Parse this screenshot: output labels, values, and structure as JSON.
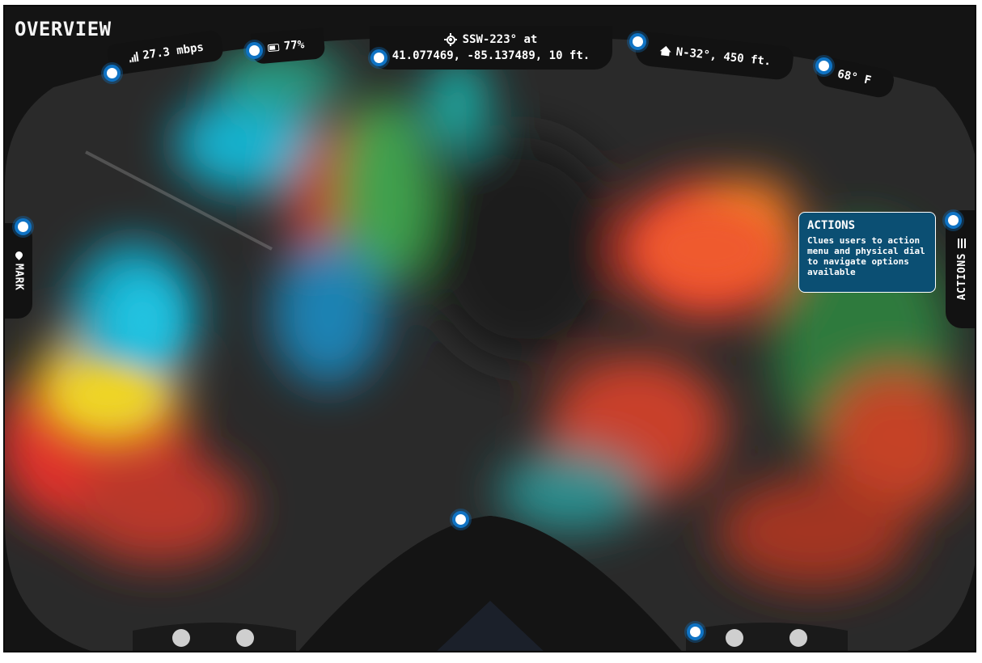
{
  "screen": {
    "title": "OVERVIEW"
  },
  "status": {
    "signal": {
      "icon": "signal-bars-icon",
      "value": "27.3 mbps"
    },
    "battery": {
      "icon": "battery-icon",
      "value": "77%"
    },
    "location": {
      "icon": "crosshair-icon",
      "heading": "SSW-223° at",
      "coordinates": "41.077469, -85.137489, 10 ft."
    },
    "home": {
      "icon": "home-icon",
      "value": "N-32°, 450 ft."
    },
    "temperature": {
      "value": "68° F"
    }
  },
  "left_tab": {
    "icon": "marker-icon",
    "label": "MARK"
  },
  "right_tab": {
    "icon": "menu-icon",
    "label": "ACTIONS"
  },
  "callout": {
    "title": "ACTIONS",
    "body": "Clues users to action menu and physical dial to navigate options available"
  },
  "colors": {
    "accent": "#0f73c4",
    "callout_bg": "#0b4f73",
    "hud_bg": "#121212"
  }
}
